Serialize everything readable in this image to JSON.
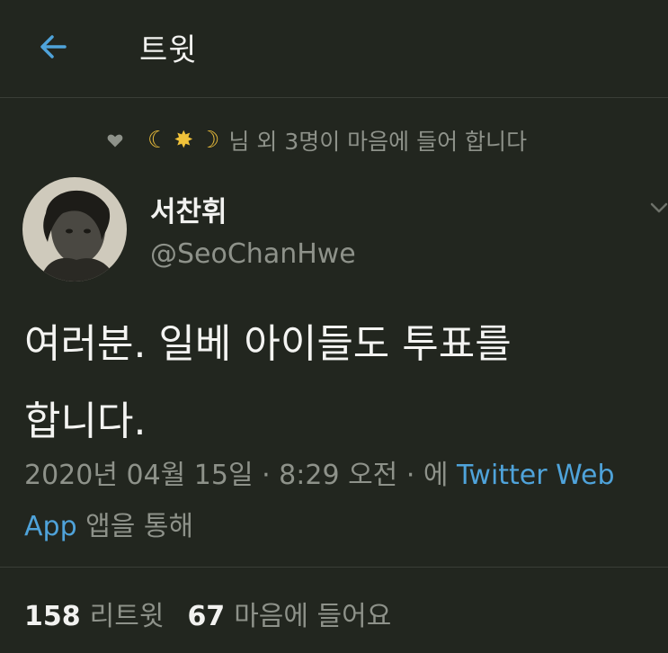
{
  "header": {
    "title": "트윗"
  },
  "social_context": {
    "emojis": [
      "☾",
      "✸",
      "☽"
    ],
    "text": "님 외 3명이 마음에 들어 합니다"
  },
  "author": {
    "display_name": "서찬휘",
    "handle": "@SeoChanHwe"
  },
  "tweet": {
    "text_line1": "여러분. 일베 아이들도 투표를",
    "text_line2": "합니다."
  },
  "meta": {
    "timestamp": "2020년 04월 15일 · 8:29 오전 · 에",
    "source": "Twitter Web App",
    "suffix": "앱을 통해"
  },
  "stats": {
    "retweets_count": "158",
    "retweets_label": "리트윗",
    "likes_count": "67",
    "likes_label": "마음에 들어요"
  },
  "colors": {
    "background": "#22261f",
    "accent": "#4fa3da",
    "muted": "#8e928a"
  }
}
